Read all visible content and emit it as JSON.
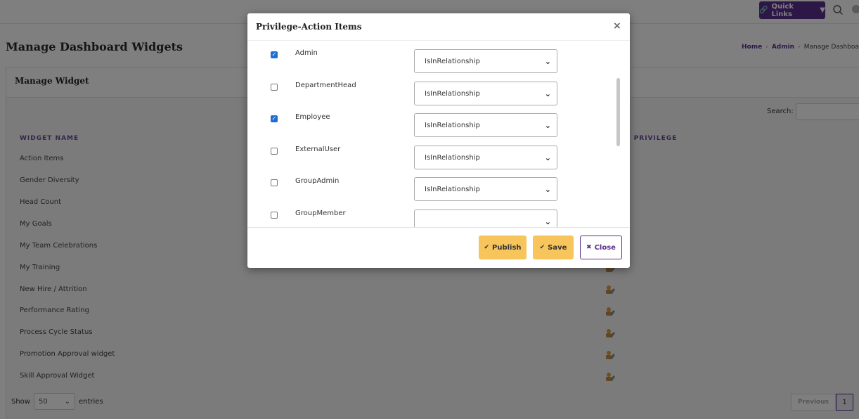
{
  "topbar": {
    "quick_links_label": "Quick Links",
    "quick_links_icon": "link-icon",
    "search_icon": "search-icon"
  },
  "page": {
    "title": "Manage Dashboard Widgets",
    "breadcrumb": [
      "Home",
      "Admin",
      "Manage Dashboa"
    ]
  },
  "card": {
    "title": "Manage Widget",
    "search_label": "Search:",
    "columns": [
      "WIDGET NAME",
      "GE PRIVILEGE"
    ],
    "rows": [
      "Action Items",
      "Gender Diversity",
      "Head Count",
      "My Goals",
      "My Team Celebrations",
      "My Training",
      "New Hire / Attrition",
      "Performance Rating",
      "Process Cycle Status",
      "Promotion Approval widget",
      "Skill Approval Widget"
    ],
    "row_action_icon": "edit-privilege-icon",
    "show_label": "Show",
    "page_length": "50",
    "entries_label": "entries",
    "previous_label": "Previous",
    "current_page": "1"
  },
  "modal": {
    "title": "Privilege-Action Items",
    "close_x": "×",
    "roles": [
      {
        "name": "Admin",
        "checked": true,
        "relationship": "IsInRelationship"
      },
      {
        "name": "DepartmentHead",
        "checked": false,
        "relationship": "IsInRelationship"
      },
      {
        "name": "Employee",
        "checked": true,
        "relationship": "IsInRelationship"
      },
      {
        "name": "ExternalUser",
        "checked": false,
        "relationship": "IsInRelationship"
      },
      {
        "name": "GroupAdmin",
        "checked": false,
        "relationship": "IsInRelationship"
      },
      {
        "name": "GroupMember",
        "checked": false,
        "relationship": ""
      }
    ],
    "buttons": {
      "publish": "Publish",
      "save": "Save",
      "close": "Close"
    },
    "colors": {
      "accent": "#5a2e8c",
      "button_yellow": "#f7c55c",
      "checkbox_blue": "#1f6fd1"
    }
  }
}
